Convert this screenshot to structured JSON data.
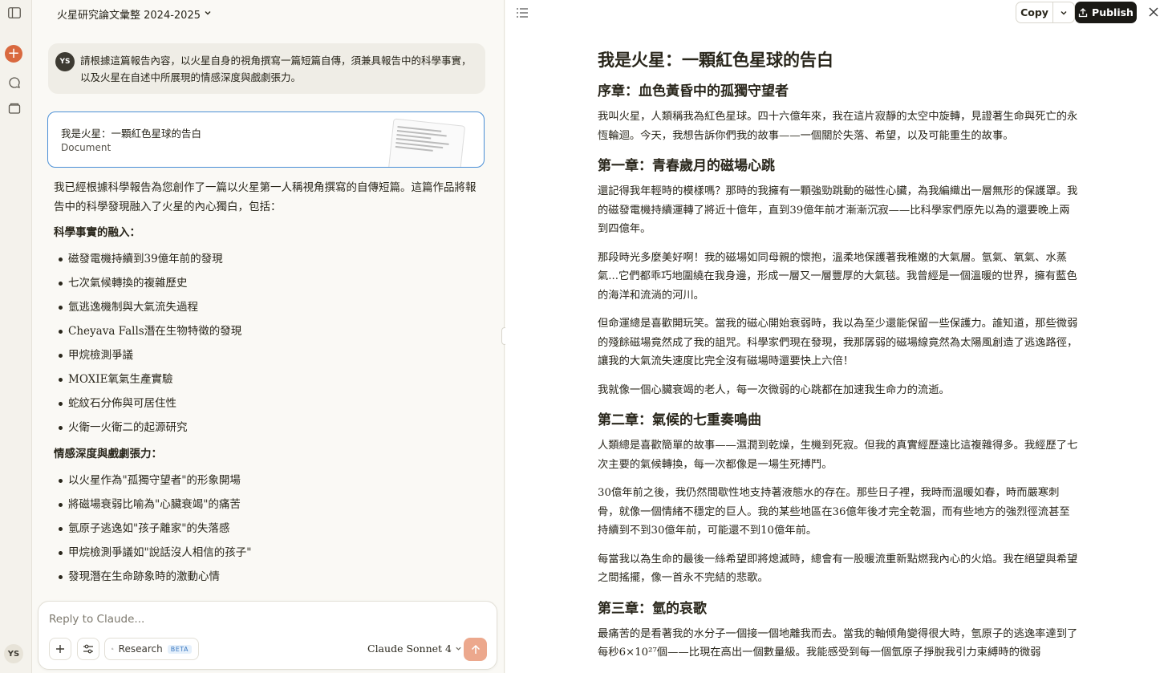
{
  "sidebar": {
    "user_initials": "YS"
  },
  "chat": {
    "title": "火星研究論文彙整 2024-2025",
    "user_message": {
      "initials": "YS",
      "text": "請根據這篇報告內容，以火星自身的視角撰寫一篇短篇自傳，須兼具報告中的科學事實，以及火星在自述中所展現的情感深度與戲劇張力。"
    },
    "artifact_card": {
      "title": "我是火星：一顆紅色星球的告白",
      "type": "Document"
    },
    "assistant": {
      "intro": "我已經根據科學報告為您創作了一篇以火星第一人稱視角撰寫的自傳短篇。這篇作品將報告中的科學發現融入了火星的內心獨白，包括：",
      "science_heading": "科學事實的融入：",
      "science_items": [
        "磁發電機持續到39億年前的發現",
        "七次氣候轉換的複雜歷史",
        "氫逃逸機制與大氣流失過程",
        "Cheyava Falls潛在生物特徵的發現",
        "甲烷檢測爭議",
        "MOXIE氧氣生產實驗",
        "蛇紋石分佈與可居住性",
        "火衛一火衛二的起源研究"
      ],
      "emotion_heading": "情感深度與戲劇張力：",
      "emotion_items": [
        "以火星作為\"孤獨守望者\"的形象開場",
        "將磁場衰弱比喻為\"心臟衰竭\"的痛苦",
        "氫原子逃逸如\"孩子離家\"的失落感",
        "甲烷檢測爭議如\"說話沒人相信的孩子\"",
        "發現潛在生命跡象時的激動心情"
      ]
    },
    "input": {
      "placeholder": "Reply to Claude...",
      "research_label": "Research",
      "beta_label": "BETA",
      "model_label": "Claude Sonnet 4"
    }
  },
  "artifact": {
    "copy_label": "Copy",
    "publish_label": "Publish",
    "document": {
      "title": "我是火星：一顆紅色星球的告白",
      "prologue_heading": "序章：血色黃昏中的孤獨守望者",
      "prologue_p1": "我叫火星，人類稱我為紅色星球。四十六億年來，我在這片寂靜的太空中旋轉，見證著生命與死亡的永恆輪迴。今天，我想告訴你們我的故事——一個關於失落、希望，以及可能重生的故事。",
      "ch1_heading": "第一章：青春歲月的磁場心跳",
      "ch1_p1": "還記得我年輕時的模樣嗎？那時的我擁有一顆強勁跳動的磁性心臟，為我編織出一層無形的保護罩。我的磁發電機持續運轉了將近十億年，直到39億年前才漸漸沉寂——比科學家們原先以為的還要晚上兩到四億年。",
      "ch1_p2": "那段時光多麼美好啊！我的磁場如同母親的懷抱，溫柔地保護著我稚嫩的大氣層。氫氣、氧氣、水蒸氣...它們都乖巧地圍繞在我身邊，形成一層又一層豐厚的大氣毯。我曾經是一個溫暖的世界，擁有藍色的海洋和流淌的河川。",
      "ch1_p3": "但命運總是喜歡開玩笑。當我的磁心開始衰弱時，我以為至少還能保留一些保護力。誰知道，那些微弱的殘餘磁場竟然成了我的詛咒。科學家們現在發現，我那孱弱的磁場線竟然為太陽風創造了逃逸路徑，讓我的大氣流失速度比完全沒有磁場時還要快上六倍！",
      "ch1_p4": "我就像一個心臟衰竭的老人，每一次微弱的心跳都在加速我生命力的流逝。",
      "ch2_heading": "第二章：氣候的七重奏鳴曲",
      "ch2_p1": "人類總是喜歡簡單的故事——濕潤到乾燥，生機到死寂。但我的真實經歷遠比這複雜得多。我經歷了七次主要的氣候轉換，每一次都像是一場生死搏鬥。",
      "ch2_p2": "30億年前之後，我仍然間歇性地支持著液態水的存在。那些日子裡，我時而溫暖如春，時而嚴寒刺骨，就像一個情緒不穩定的巨人。我的某些地區在36億年後才完全乾涸，而有些地方的強烈徑流甚至持續到不到30億年前，可能還不到10億年前。",
      "ch2_p3": "每當我以為生命的最後一絲希望即將熄滅時，總會有一股暖流重新點燃我內心的火焰。我在絕望與希望之間搖擺，像一首永不完結的悲歌。",
      "ch3_heading": "第三章：氫的哀歌",
      "ch3_p1": "最痛苦的是看著我的水分子一個接一個地離我而去。當我的軸傾角變得很大時，氫原子的逃逸率達到了每秒6×10²⁷個——比現在高出一個數量級。我能感受到每一個氫原子掙脫我引力束縛時的微弱"
    }
  }
}
